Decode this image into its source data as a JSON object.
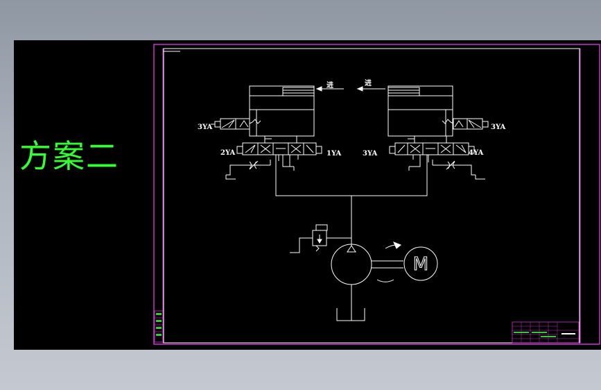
{
  "scheme_title": "方案二",
  "flow_label_left": "进",
  "flow_label_right": "进",
  "left_top_solenoid": "3YA",
  "right_top_solenoid": "3YA",
  "left_valve_left_solenoid": "2YA",
  "left_valve_right_solenoid": "1YA",
  "right_valve_left_solenoid": "3YA",
  "right_valve_right_solenoid": "4YA",
  "motor_letter": "M",
  "colors": {
    "background": "#000000",
    "drawing_lines": "#ffffff",
    "frame": "#cc33cc",
    "scheme_title": "#33ff33",
    "title_block_text": "#33cc33"
  }
}
